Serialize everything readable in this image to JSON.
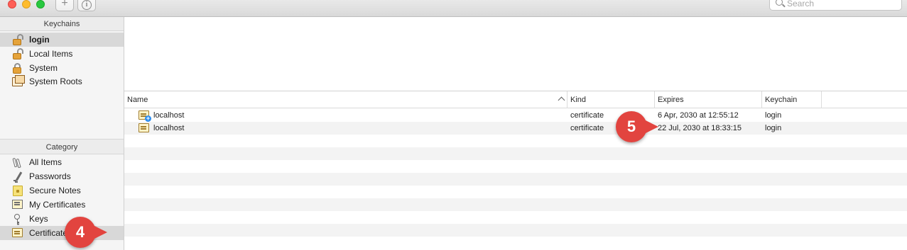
{
  "toolbar": {
    "add_label": "+",
    "info_label": "i",
    "search_placeholder": "Search"
  },
  "sidebar": {
    "keychains_header": "Keychains",
    "keychains": [
      {
        "label": "login",
        "icon": "lock-open-icon",
        "selected": true
      },
      {
        "label": "Local Items",
        "icon": "lock-open-icon"
      },
      {
        "label": "System",
        "icon": "lock-closed-icon"
      },
      {
        "label": "System Roots",
        "icon": "system-roots-icon"
      }
    ],
    "category_header": "Category",
    "categories": [
      {
        "label": "All Items",
        "icon": "all-items-icon"
      },
      {
        "label": "Passwords",
        "icon": "password-icon"
      },
      {
        "label": "Secure Notes",
        "icon": "secure-note-icon"
      },
      {
        "label": "My Certificates",
        "icon": "my-certificate-icon"
      },
      {
        "label": "Keys",
        "icon": "key-icon"
      },
      {
        "label": "Certificates",
        "icon": "certificate-icon",
        "selected": true
      }
    ]
  },
  "table": {
    "columns": {
      "name": "Name",
      "kind": "Kind",
      "expires": "Expires",
      "keychain": "Keychain"
    },
    "rows": [
      {
        "name": "localhost",
        "kind": "certificate",
        "expires": "6 Apr, 2030 at 12:55:12",
        "keychain": "login",
        "icon": "certificate-plus-icon"
      },
      {
        "name": "localhost",
        "kind": "certificate",
        "expires": "22 Jul, 2030 at 18:33:15",
        "keychain": "login",
        "icon": "certificate-icon"
      }
    ]
  },
  "callouts": {
    "step4": "4",
    "step5": "5"
  },
  "colors": {
    "callout": "#e2443f",
    "selected_row": "#d8d8d8",
    "alt_row": "#f3f3f3"
  }
}
